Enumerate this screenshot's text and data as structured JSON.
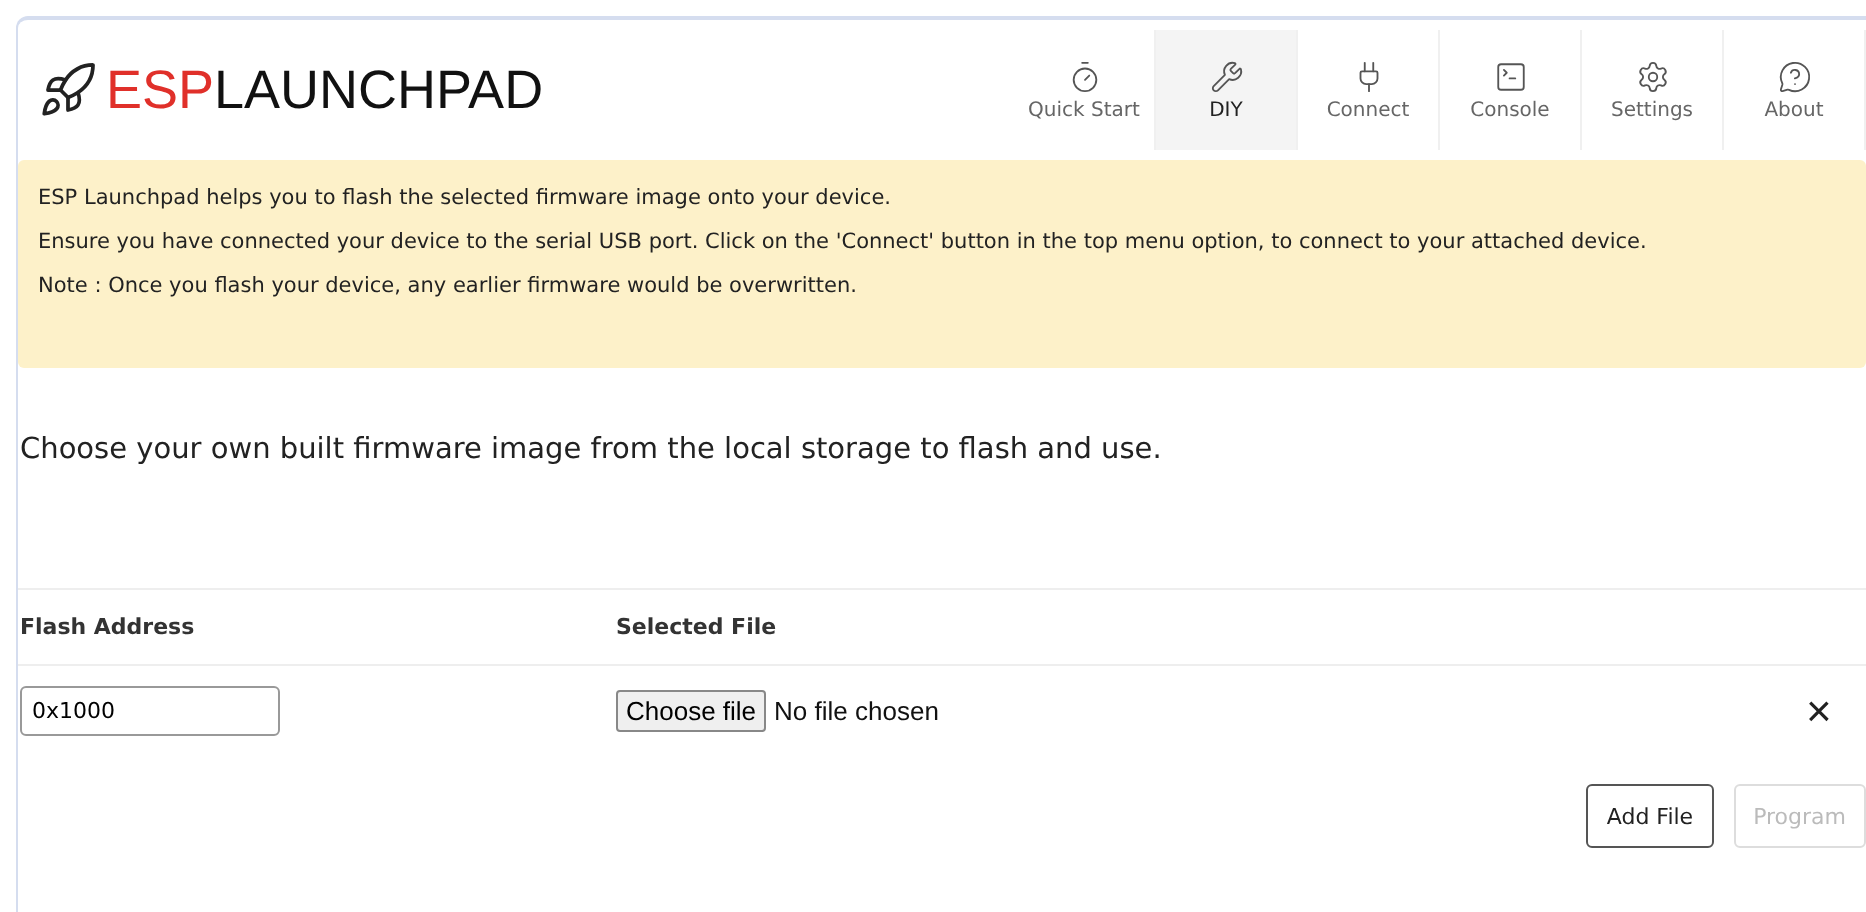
{
  "logo": {
    "accent": "ESP",
    "rest": "LAUNCHPAD"
  },
  "nav": [
    {
      "label": "Quick Start",
      "selected": false
    },
    {
      "label": "DIY",
      "selected": true
    },
    {
      "label": "Connect",
      "selected": false
    },
    {
      "label": "Console",
      "selected": false
    },
    {
      "label": "Settings",
      "selected": false
    },
    {
      "label": "About",
      "selected": false
    }
  ],
  "notice": [
    "ESP Launchpad helps you to flash the selected firmware image onto your device.",
    "Ensure you have connected your device to the serial USB port. Click on the 'Connect' button in the top menu option, to connect to your attached device.",
    "Note : Once you flash your device, any earlier firmware would be overwritten."
  ],
  "intro": "Choose your own built firmware image from the local storage to flash and use.",
  "table": {
    "columns": [
      "Flash Address",
      "Selected File"
    ],
    "rows": [
      {
        "address": "0x1000",
        "file_button": "Choose file",
        "file_status": "No file chosen",
        "remove": "×"
      }
    ]
  },
  "buttons": [
    {
      "label": "Add File",
      "disabled": false
    },
    {
      "label": "Program",
      "disabled": true
    }
  ]
}
